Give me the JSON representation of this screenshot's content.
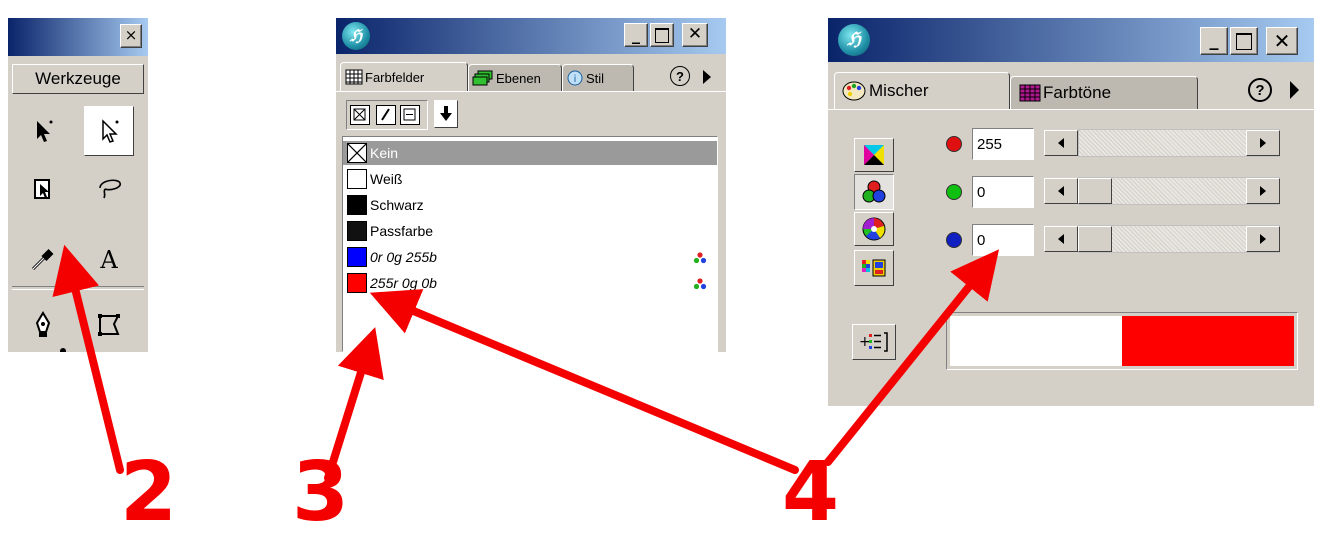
{
  "tools_panel": {
    "title": "Werkzeuge",
    "close_glyph": "×"
  },
  "swatches_panel": {
    "tabs": [
      "Farbfelder",
      "Ebenen",
      "Stil"
    ],
    "help_glyph": "?",
    "items": [
      {
        "label": "Kein",
        "color": "none",
        "selected": true,
        "italic": false,
        "mode_icon": ""
      },
      {
        "label": "Weiß",
        "color": "#ffffff",
        "selected": false,
        "italic": false,
        "mode_icon": ""
      },
      {
        "label": "Schwarz",
        "color": "#000000",
        "selected": false,
        "italic": false,
        "mode_icon": ""
      },
      {
        "label": "Passfarbe",
        "color": "#111111",
        "selected": false,
        "italic": false,
        "mode_icon": ""
      },
      {
        "label": "0r 0g 255b",
        "color": "#0000ff",
        "selected": false,
        "italic": true,
        "mode_icon": "rgb-dots-icon"
      },
      {
        "label": "255r 0g 0b",
        "color": "#ff0000",
        "selected": false,
        "italic": true,
        "mode_icon": "rgb-dots-icon"
      }
    ]
  },
  "mixer_panel": {
    "tabs": [
      "Mischer",
      "Farbtöne"
    ],
    "help_glyph": "?",
    "channels": [
      {
        "name": "red",
        "color": "#e01010",
        "value": "255",
        "fraction": 1.0
      },
      {
        "name": "green",
        "color": "#10c010",
        "value": "0",
        "fraction": 0.0
      },
      {
        "name": "blue",
        "color": "#1020c0",
        "value": "0",
        "fraction": 0.0
      }
    ],
    "preview": {
      "old_color": "#ffffff",
      "new_color": "#ff0000"
    }
  },
  "annotations": {
    "labels": [
      "2",
      "3",
      "4"
    ],
    "arrow_color": "#f50000"
  }
}
